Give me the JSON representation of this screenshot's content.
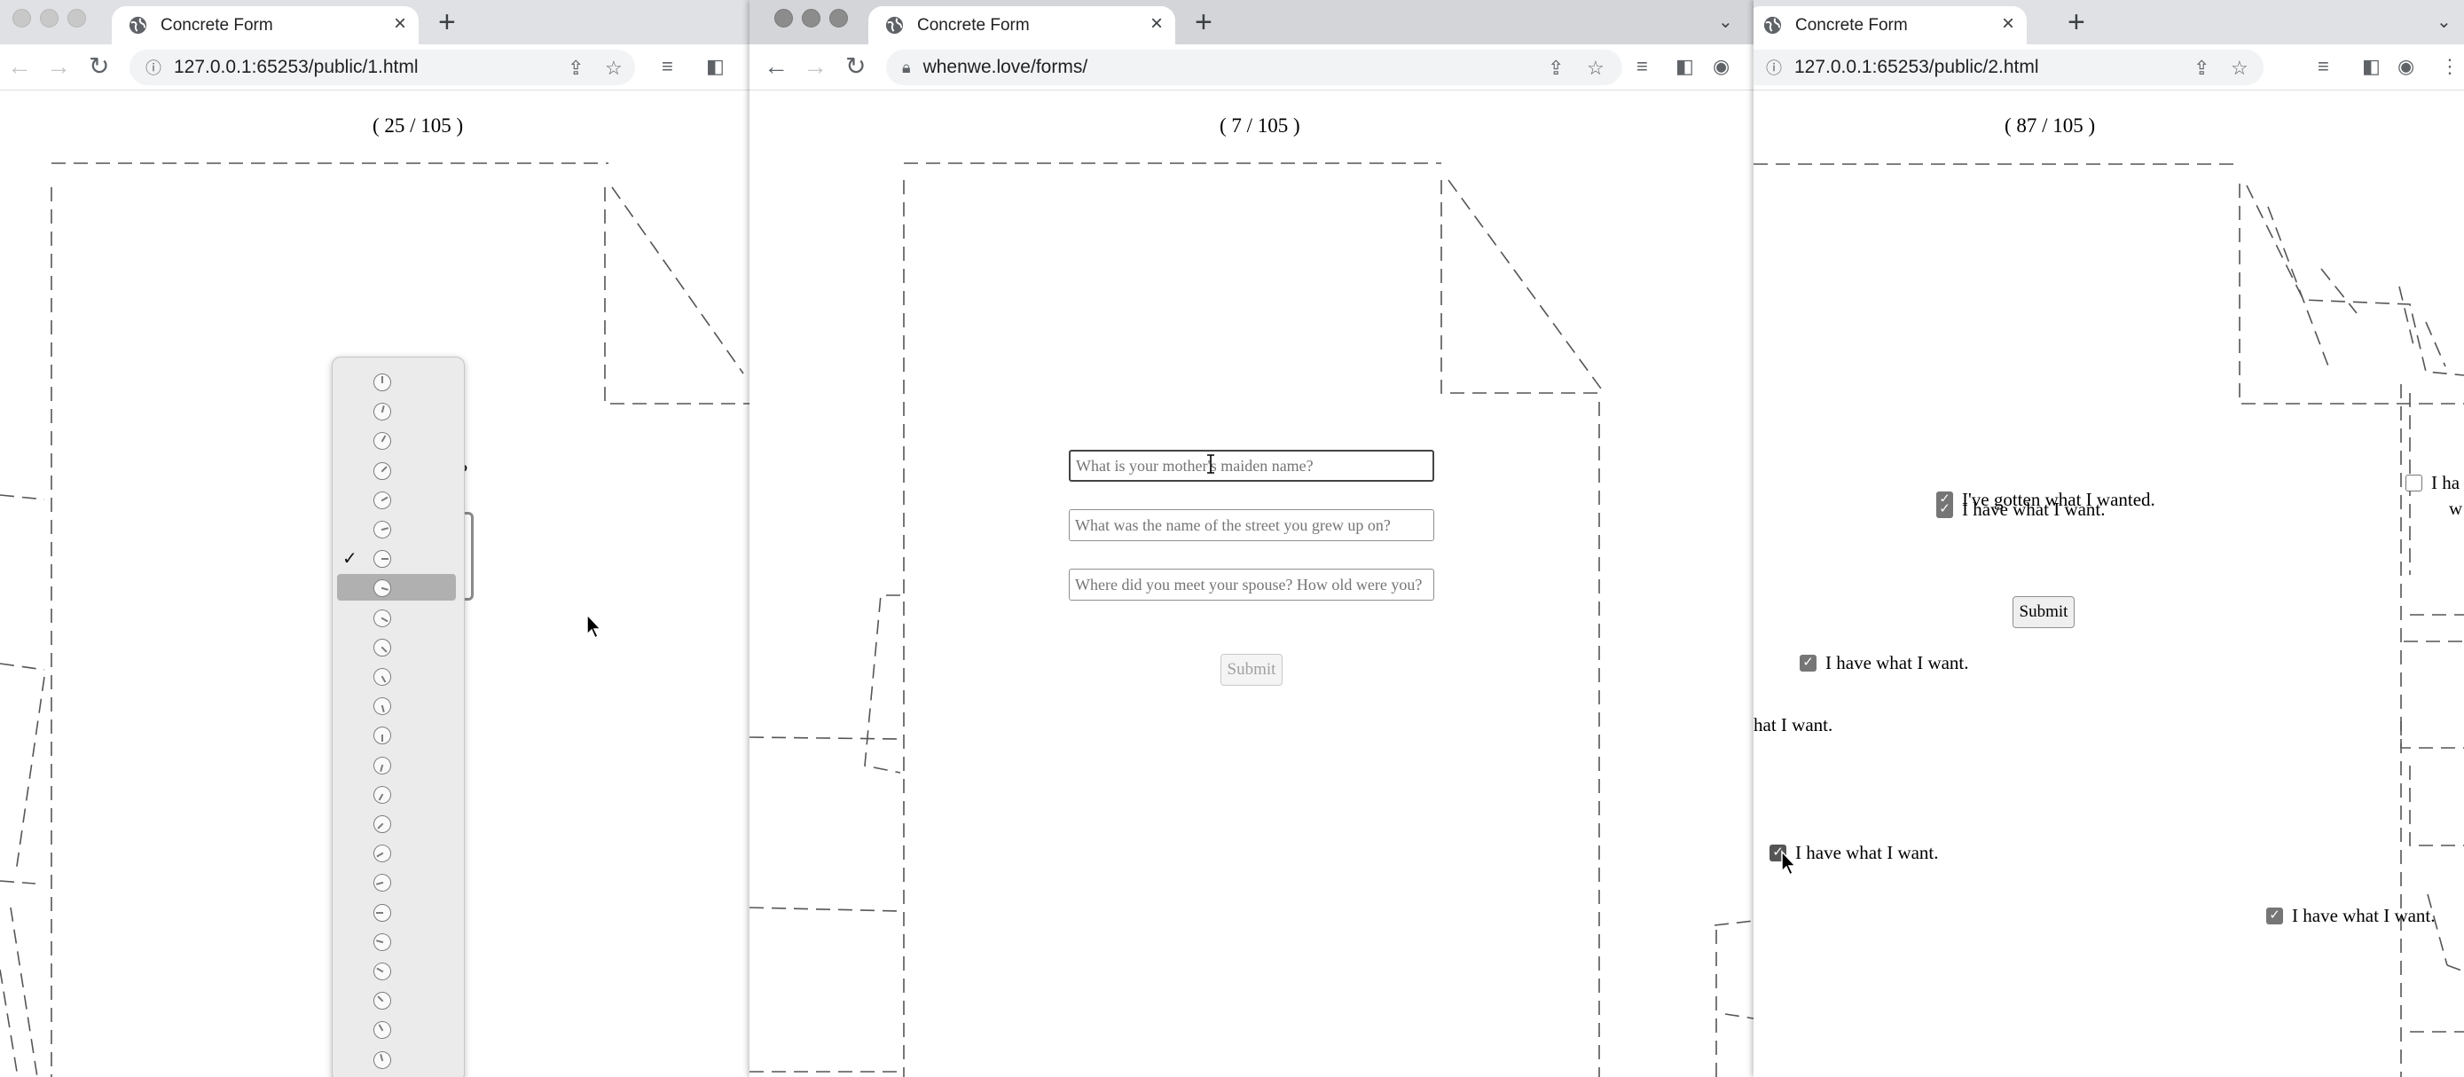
{
  "windows": [
    {
      "tab_title": "Concrete Form",
      "url": "127.0.0.1:65253/public/1.html",
      "counter": "( 25 / 105 )",
      "fragment_text": "t?",
      "dropdown_selected_index": 6,
      "dropdown_highlight_index": 7,
      "dropdown_option_count": 24
    },
    {
      "tab_title": "Concrete Form",
      "url": "whenwe.love/forms/",
      "counter": "( 7 / 105 )",
      "inputs": [
        {
          "placeholder": "What is your mother's maiden name?"
        },
        {
          "placeholder": "What was the name of the street you grew up on?"
        },
        {
          "placeholder": "Where did you meet your spouse? How old were you?"
        }
      ],
      "submit_label": "Submit"
    },
    {
      "tab_title": "Concrete Form",
      "url": "127.0.0.1:65253/public/2.html",
      "counter": "( 87 / 105 )",
      "checkbox_labels": [
        "I've gotten what I wanted.",
        "I have what I want.",
        "I have what I want.",
        "hat I want.",
        "I have what I want.",
        "I have what I want.",
        "I ha",
        "w"
      ],
      "submit_label": "Submit"
    }
  ],
  "icons": {
    "back": "arrow-left-icon",
    "forward": "arrow-right-icon",
    "reload": "reload-icon",
    "info": "info-icon",
    "lock": "lock-icon",
    "share": "share-icon",
    "bookmark": "star-icon",
    "media": "media-control-icon",
    "sidepanel": "side-panel-icon",
    "profile": "profile-icon",
    "menu": "kebab-menu-icon"
  },
  "colors": {
    "tabstrip": "#dfe1e5",
    "dash": "#555555",
    "checkbox": "#767676"
  }
}
